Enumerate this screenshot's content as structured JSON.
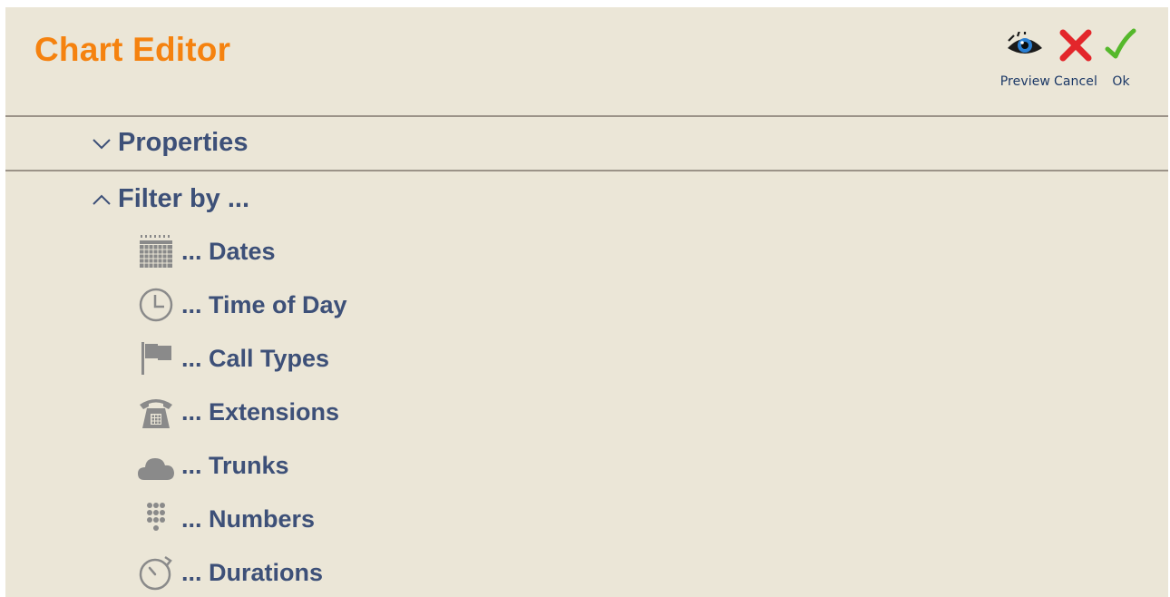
{
  "header": {
    "title": "Chart Editor",
    "actions": [
      {
        "label": "Preview",
        "icon": "eye-icon"
      },
      {
        "label": "Cancel",
        "icon": "close-icon"
      },
      {
        "label": "Ok",
        "icon": "checkmark-icon"
      }
    ]
  },
  "sections": {
    "properties": {
      "label": "Properties",
      "state": "collapsed",
      "icon": "chevron-down-icon"
    },
    "filter": {
      "label": "Filter by ...",
      "state": "expanded",
      "icon": "chevron-up-icon",
      "items": [
        {
          "label": "... Dates",
          "icon": "calendar-icon"
        },
        {
          "label": "... Time of Day",
          "icon": "clock-icon"
        },
        {
          "label": "... Call Types",
          "icon": "flag-icon"
        },
        {
          "label": "... Extensions",
          "icon": "telephone-icon"
        },
        {
          "label": "... Trunks",
          "icon": "cloud-icon"
        },
        {
          "label": "... Numbers",
          "icon": "keypad-icon"
        },
        {
          "label": "... Durations",
          "icon": "stopwatch-icon"
        }
      ]
    }
  },
  "colors": {
    "background": "#ebe6d7",
    "title": "#f5820f",
    "text": "#3d5078",
    "action_label": "#1b3866",
    "cancel": "#e3262b",
    "ok": "#55b82b",
    "divider": "#9b9388",
    "icon_gray": "#8a8a8a"
  }
}
